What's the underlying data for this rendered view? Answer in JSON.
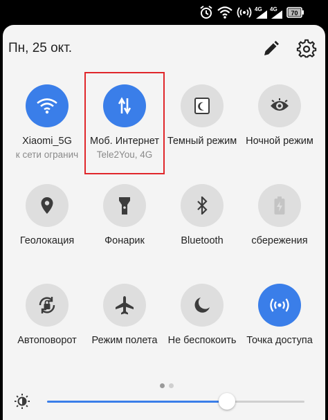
{
  "status_bar": {
    "icons": [
      "alarm-icon",
      "wifi-icon",
      "signal-strength-icon",
      "lte-4g-signal-icon",
      "lte-4g-signal-icon-2",
      "battery-icon"
    ],
    "battery_level": "70"
  },
  "header": {
    "date": "Пн, 25 окт.",
    "edit_icon": "pencil-icon",
    "settings_icon": "gear-icon"
  },
  "tiles": [
    {
      "label": "Xiaomi_5G",
      "sub": "к сети огранич",
      "icon": "wifi-icon",
      "active": true
    },
    {
      "label": "Моб. Интернет",
      "sub": "Tele2You, 4G",
      "icon": "mobile-data-icon",
      "active": true
    },
    {
      "label": "Темный режим",
      "sub": "",
      "icon": "dark-mode-icon",
      "active": false
    },
    {
      "label": "Ночной режим",
      "sub": "",
      "icon": "eye-icon",
      "active": false
    },
    {
      "label": "Геолокация",
      "sub": "",
      "icon": "location-icon",
      "active": false
    },
    {
      "label": "Фонарик",
      "sub": "",
      "icon": "flashlight-icon",
      "active": false
    },
    {
      "label": "Bluetooth",
      "sub": "",
      "icon": "bluetooth-icon",
      "active": false
    },
    {
      "label": "сбережения",
      "sub": "",
      "icon": "battery-saver-icon",
      "active": false
    },
    {
      "label": "Автоповорот",
      "sub": "",
      "icon": "auto-rotate-icon",
      "active": false
    },
    {
      "label": "Режим полета",
      "sub": "",
      "icon": "airplane-icon",
      "active": false
    },
    {
      "label": "Не беспокоить",
      "sub": "",
      "icon": "moon-icon",
      "active": false
    },
    {
      "label": "Точка доступа",
      "sub": "",
      "icon": "hotspot-icon",
      "active": true
    }
  ],
  "page_indicator": {
    "pages": 2,
    "current": 1
  },
  "brightness": {
    "level": 0.7,
    "icon": "brightness-icon"
  },
  "colors": {
    "accent": "#3a7ee9",
    "tile_off": "#dedede",
    "highlight": "#e0262a"
  }
}
